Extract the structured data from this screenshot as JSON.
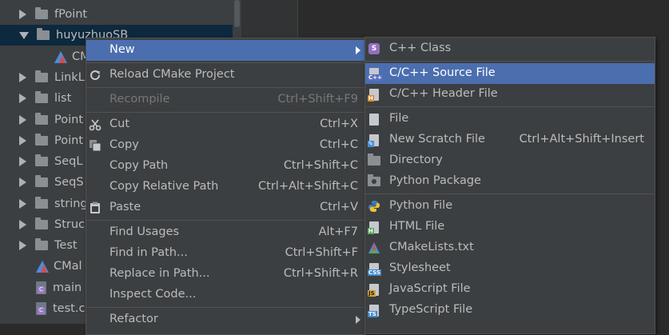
{
  "tree": {
    "items": [
      {
        "label": "fPoint",
        "arrow": "right",
        "icon": "folder"
      },
      {
        "label": "huyuzhuoSB",
        "arrow": "down",
        "icon": "folder",
        "selected": true
      },
      {
        "label": "CM",
        "arrow": "none",
        "icon": "cmake",
        "indent": 1
      },
      {
        "label": "LinkL",
        "arrow": "right",
        "icon": "folder"
      },
      {
        "label": "list",
        "arrow": "right",
        "icon": "folder"
      },
      {
        "label": "Point",
        "arrow": "right",
        "icon": "folder"
      },
      {
        "label": "Point",
        "arrow": "right",
        "icon": "folder"
      },
      {
        "label": "SeqL",
        "arrow": "right",
        "icon": "folder"
      },
      {
        "label": "SeqS",
        "arrow": "right",
        "icon": "folder"
      },
      {
        "label": "string",
        "arrow": "right",
        "icon": "folder"
      },
      {
        "label": "Struc",
        "arrow": "right",
        "icon": "folder"
      },
      {
        "label": "Test",
        "arrow": "right",
        "icon": "folder"
      },
      {
        "label": "CMal",
        "arrow": "none",
        "icon": "cmake"
      },
      {
        "label": "main",
        "arrow": "none",
        "icon": "cfile"
      },
      {
        "label": "test.c",
        "arrow": "none",
        "icon": "cfile"
      }
    ]
  },
  "context_menu": {
    "items": [
      {
        "type": "item",
        "label": "New",
        "submenu": true,
        "highlighted": true,
        "name": "menu-item-new"
      },
      {
        "type": "sep"
      },
      {
        "type": "item",
        "label": "Reload CMake Project",
        "icon": "reload-icon",
        "name": "menu-item-reload-cmake"
      },
      {
        "type": "sep"
      },
      {
        "type": "item",
        "label": "Recompile",
        "shortcut": "Ctrl+Shift+F9",
        "disabled": true,
        "name": "menu-item-recompile"
      },
      {
        "type": "sep"
      },
      {
        "type": "item",
        "label": "Cut",
        "shortcut": "Ctrl+X",
        "icon": "scissors-icon",
        "name": "menu-item-cut"
      },
      {
        "type": "item",
        "label": "Copy",
        "shortcut": "Ctrl+C",
        "icon": "copy-icon",
        "name": "menu-item-copy"
      },
      {
        "type": "item",
        "label": "Copy Path",
        "shortcut": "Ctrl+Shift+C",
        "name": "menu-item-copy-path"
      },
      {
        "type": "item",
        "label": "Copy Relative Path",
        "shortcut": "Ctrl+Alt+Shift+C",
        "name": "menu-item-copy-relative-path"
      },
      {
        "type": "item",
        "label": "Paste",
        "shortcut": "Ctrl+V",
        "icon": "clipboard-icon",
        "name": "menu-item-paste"
      },
      {
        "type": "sep"
      },
      {
        "type": "item",
        "label": "Find Usages",
        "shortcut": "Alt+F7",
        "name": "menu-item-find-usages"
      },
      {
        "type": "item",
        "label": "Find in Path...",
        "shortcut": "Ctrl+Shift+F",
        "name": "menu-item-find-in-path"
      },
      {
        "type": "item",
        "label": "Replace in Path...",
        "shortcut": "Ctrl+Shift+R",
        "name": "menu-item-replace-in-path"
      },
      {
        "type": "item",
        "label": "Inspect Code...",
        "name": "menu-item-inspect-code"
      },
      {
        "type": "sep"
      },
      {
        "type": "item",
        "label": "Refactor",
        "submenu": true,
        "name": "menu-item-refactor"
      }
    ]
  },
  "new_submenu": {
    "items": [
      {
        "type": "item",
        "label": "C++ Class",
        "icon": "cpp-class-icon",
        "name": "submenu-item-cpp-class"
      },
      {
        "type": "sep"
      },
      {
        "type": "item",
        "label": "C/C++ Source File",
        "icon": "cpp-source-icon",
        "highlighted": true,
        "name": "submenu-item-cpp-source-file"
      },
      {
        "type": "item",
        "label": "C/C++ Header File",
        "icon": "cpp-header-icon",
        "name": "submenu-item-cpp-header-file"
      },
      {
        "type": "sep"
      },
      {
        "type": "item",
        "label": "File",
        "icon": "file-icon",
        "name": "submenu-item-file"
      },
      {
        "type": "item",
        "label": "New Scratch File",
        "shortcut": "Ctrl+Alt+Shift+Insert",
        "icon": "scratch-file-icon",
        "name": "submenu-item-new-scratch-file"
      },
      {
        "type": "item",
        "label": "Directory",
        "icon": "directory-icon",
        "name": "submenu-item-directory"
      },
      {
        "type": "item",
        "label": "Python Package",
        "icon": "python-package-icon",
        "name": "submenu-item-python-package"
      },
      {
        "type": "sep"
      },
      {
        "type": "item",
        "label": "Python File",
        "icon": "python-icon",
        "name": "submenu-item-python-file"
      },
      {
        "type": "item",
        "label": "HTML File",
        "icon": "html-icon",
        "name": "submenu-item-html-file"
      },
      {
        "type": "item",
        "label": "CMakeLists.txt",
        "icon": "cmake-icon",
        "name": "submenu-item-cmakelists"
      },
      {
        "type": "item",
        "label": "Stylesheet",
        "icon": "css-icon",
        "name": "submenu-item-stylesheet"
      },
      {
        "type": "item",
        "label": "JavaScript File",
        "icon": "javascript-icon",
        "name": "submenu-item-javascript-file"
      },
      {
        "type": "item",
        "label": "TypeScript File",
        "icon": "typescript-icon",
        "name": "submenu-item-typescript-file"
      }
    ]
  },
  "colors": {
    "highlight": "#4b6eaf",
    "menu_bg": "#3c3f41",
    "tree_selection": "#0d293e"
  }
}
